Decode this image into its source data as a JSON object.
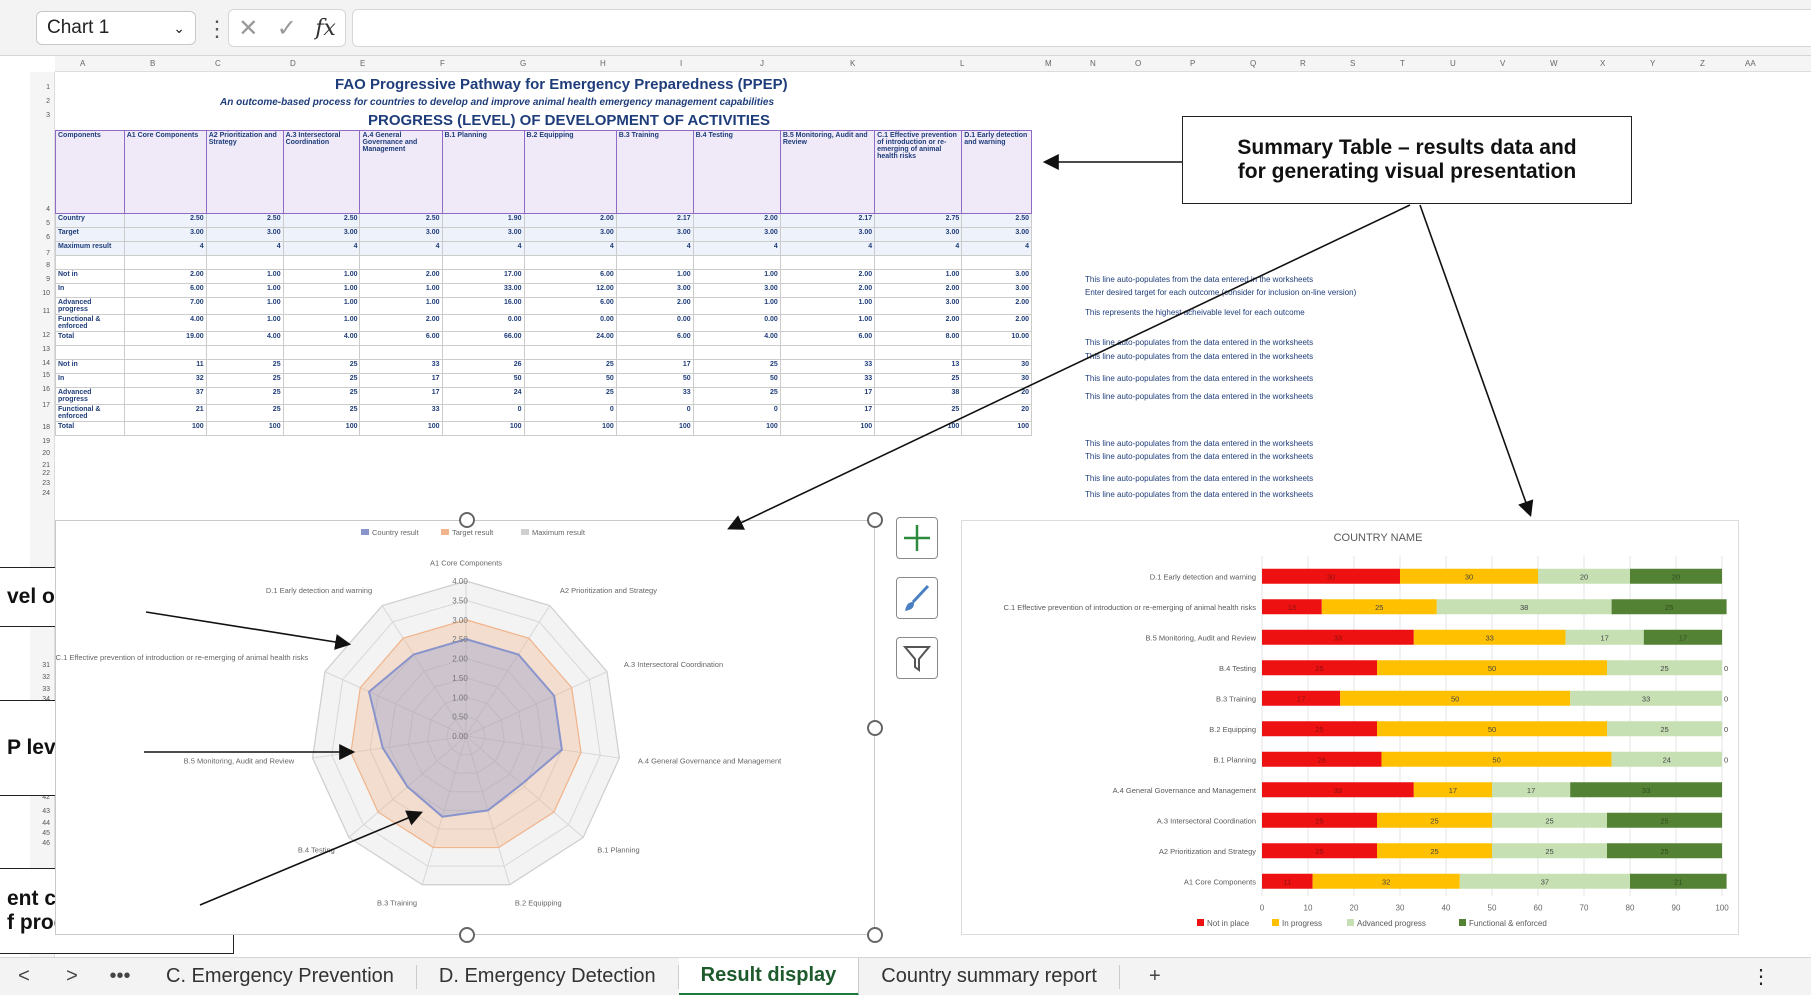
{
  "formula_bar": {
    "name_box": "Chart 1",
    "fx": "fx"
  },
  "columns": [
    "A",
    "B",
    "C",
    "D",
    "E",
    "F",
    "G",
    "H",
    "I",
    "J",
    "K",
    "L",
    "M",
    "N",
    "O",
    "P",
    "Q",
    "R",
    "S",
    "T",
    "U",
    "V",
    "W",
    "X",
    "Y",
    "Z",
    "AA"
  ],
  "rows": [
    "1",
    "2",
    "3",
    "4",
    "5",
    "6",
    "7",
    "8",
    "9",
    "10",
    "11",
    "12",
    "13",
    "14",
    "15",
    "16",
    "17",
    "18",
    "19",
    "20",
    "21",
    "22",
    "23",
    "24",
    "31",
    "32",
    "33",
    "34",
    "42",
    "43",
    "44",
    "45",
    "46"
  ],
  "sheet": {
    "title": "FAO Progressive Pathway for Emergency Preparedness (PPEP)",
    "subtitle": "An outcome-based process for countries to develop and improve animal health emergency management capabilities",
    "section": "PROGRESS (LEVEL) OF DEVELOPMENT OF ACTIVITIES",
    "headers": [
      "Components",
      "A1 Core Components",
      "A2 Prioritization and Strategy",
      "A.3 Intersectoral Coordination",
      "A.4 General Governance and Management",
      "B.1 Planning",
      "B.2 Equipping",
      "B.3 Training",
      "B.4 Testing",
      "B.5 Monitoring, Audit and Review",
      "C.1 Effective prevention of introduction or re-emerging of animal health risks",
      "D.1 Early detection and warning"
    ],
    "rows": [
      [
        "Country",
        "2.50",
        "2.50",
        "2.50",
        "2.50",
        "1.90",
        "2.00",
        "2.17",
        "2.00",
        "2.17",
        "2.75",
        "2.50"
      ],
      [
        "Target",
        "3.00",
        "3.00",
        "3.00",
        "3.00",
        "3.00",
        "3.00",
        "3.00",
        "3.00",
        "3.00",
        "3.00",
        "3.00"
      ],
      [
        "Maximum result",
        "4",
        "4",
        "4",
        "4",
        "4",
        "4",
        "4",
        "4",
        "4",
        "4",
        "4"
      ],
      [
        "",
        "",
        "",
        "",
        "",
        "",
        "",
        "",
        "",
        "",
        "",
        ""
      ],
      [
        "Not in",
        "2.00",
        "1.00",
        "1.00",
        "2.00",
        "17.00",
        "6.00",
        "1.00",
        "1.00",
        "2.00",
        "1.00",
        "3.00"
      ],
      [
        "In",
        "6.00",
        "1.00",
        "1.00",
        "1.00",
        "33.00",
        "12.00",
        "3.00",
        "3.00",
        "2.00",
        "2.00",
        "3.00"
      ],
      [
        "Advanced progress",
        "7.00",
        "1.00",
        "1.00",
        "1.00",
        "16.00",
        "6.00",
        "2.00",
        "1.00",
        "1.00",
        "3.00",
        "2.00"
      ],
      [
        "Functional & enforced",
        "4.00",
        "1.00",
        "1.00",
        "2.00",
        "0.00",
        "0.00",
        "0.00",
        "0.00",
        "1.00",
        "2.00",
        "2.00"
      ],
      [
        "Total",
        "19.00",
        "4.00",
        "4.00",
        "6.00",
        "66.00",
        "24.00",
        "6.00",
        "4.00",
        "6.00",
        "8.00",
        "10.00"
      ],
      [
        "",
        "",
        "",
        "",
        "",
        "",
        "",
        "",
        "",
        "",
        "",
        ""
      ],
      [
        "Not in",
        "11",
        "25",
        "25",
        "33",
        "26",
        "25",
        "17",
        "25",
        "33",
        "13",
        "30"
      ],
      [
        "In",
        "32",
        "25",
        "25",
        "17",
        "50",
        "50",
        "50",
        "50",
        "33",
        "25",
        "30"
      ],
      [
        "Advanced progress",
        "37",
        "25",
        "25",
        "17",
        "24",
        "25",
        "33",
        "25",
        "17",
        "38",
        "20"
      ],
      [
        "Functional & enforced",
        "21",
        "25",
        "25",
        "33",
        "0",
        "0",
        "0",
        "0",
        "17",
        "25",
        "20"
      ],
      [
        "Total",
        "100",
        "100",
        "100",
        "100",
        "100",
        "100",
        "100",
        "100",
        "100",
        "100",
        "100"
      ]
    ],
    "notes": {
      "n5": "This line auto-populates from the data entered in the worksheets",
      "n6": "Enter desired target for each outcome (consider for inclusion on-line version)",
      "n7": "This represents the highest acheivable level for each outcome",
      "n9": "This line auto-populates from the data entered in the worksheets",
      "n10": "This line auto-populates from the data entered in the worksheets",
      "n11": "This line auto-populates from the data entered in the worksheets",
      "n12": "This line auto-populates from the data entered in the worksheets",
      "n15": "This line auto-populates from the data entered in the worksheets",
      "n16": "This line auto-populates from the data entered in the worksheets",
      "n17": "This line auto-populates from the data entered in the worksheets",
      "n18": "This line auto-populates from the data entered in the worksheets"
    }
  },
  "callouts": {
    "summary_line1": "Summary Table – results data and",
    "summary_line2": "for generating visual presentation",
    "left1_line1": "vel of",
    "left2_line1": "P level of",
    "left3_line1": "ent current result",
    "left3_line2": "f progress"
  },
  "chart_data": [
    {
      "type": "radar",
      "legend": [
        "Country result",
        "Target result",
        "Maximum result"
      ],
      "categories": [
        "A1 Core Components",
        "A2 Prioritization and Strategy",
        "A.3 Intersectoral Coordination",
        "A.4 General Governance and Management",
        "B.1 Planning",
        "B.2 Equipping",
        "B.3 Training",
        "B.4 Testing",
        "B.5 Monitoring, Audit and Review",
        "C.1 Effective prevention of introduction or re-emerging of animal health risks",
        "D.1 Early detection and warning"
      ],
      "series": [
        {
          "name": "Country result",
          "values": [
            2.5,
            2.5,
            2.5,
            2.5,
            1.9,
            2.0,
            2.17,
            2.0,
            2.17,
            2.75,
            2.5
          ],
          "color": "#8a94cc"
        },
        {
          "name": "Target result",
          "values": [
            3,
            3,
            3,
            3,
            3,
            3,
            3,
            3,
            3,
            3,
            3
          ],
          "color": "#f2b48a"
        },
        {
          "name": "Maximum result",
          "values": [
            4,
            4,
            4,
            4,
            4,
            4,
            4,
            4,
            4,
            4,
            4
          ],
          "color": "#cfcfcf"
        }
      ],
      "ticks": [
        "0.00",
        "0.50",
        "1.00",
        "1.50",
        "2.00",
        "2.50",
        "3.00",
        "3.50",
        "4.00"
      ],
      "rlim": [
        0,
        4
      ]
    },
    {
      "type": "bar",
      "orientation": "horizontal-stacked",
      "title": "COUNTRY NAME",
      "categories": [
        "D.1 Early detection and warning",
        "C.1 Effective prevention of introduction or re-emerging of animal health risks",
        "B.5 Monitoring, Audit and Review",
        "B.4 Testing",
        "B.3 Training",
        "B.2 Equipping",
        "B.1 Planning",
        "A.4 General Governance and Management",
        "A.3 Intersectoral Coordination",
        "A2 Prioritization and Strategy",
        "A1 Core Components"
      ],
      "series": [
        {
          "name": "Not in place",
          "values": [
            30,
            13,
            33,
            25,
            17,
            25,
            26,
            33,
            25,
            25,
            11
          ],
          "color": "#ee1111"
        },
        {
          "name": "In progress",
          "values": [
            30,
            25,
            33,
            50,
            50,
            50,
            50,
            17,
            25,
            25,
            32
          ],
          "color": "#ffc000"
        },
        {
          "name": "Advanced progress",
          "values": [
            20,
            38,
            17,
            25,
            33,
            25,
            24,
            17,
            25,
            25,
            37
          ],
          "color": "#c6e0b4"
        },
        {
          "name": "Functional & enforced",
          "values": [
            20,
            25,
            17,
            0,
            0,
            0,
            0,
            33,
            25,
            25,
            21
          ],
          "color": "#548235"
        }
      ],
      "xticks": [
        "0",
        "10",
        "20",
        "30",
        "40",
        "50",
        "60",
        "70",
        "80",
        "90",
        "100"
      ],
      "xlim": [
        0,
        100
      ]
    }
  ],
  "tabs": [
    "C. Emergency Prevention",
    "D. Emergency Detection",
    "Result display",
    "Country summary report"
  ],
  "nav": {
    "prev": "<",
    "next": ">",
    "more": "•••",
    "add": "+",
    "menu": "⋮"
  }
}
